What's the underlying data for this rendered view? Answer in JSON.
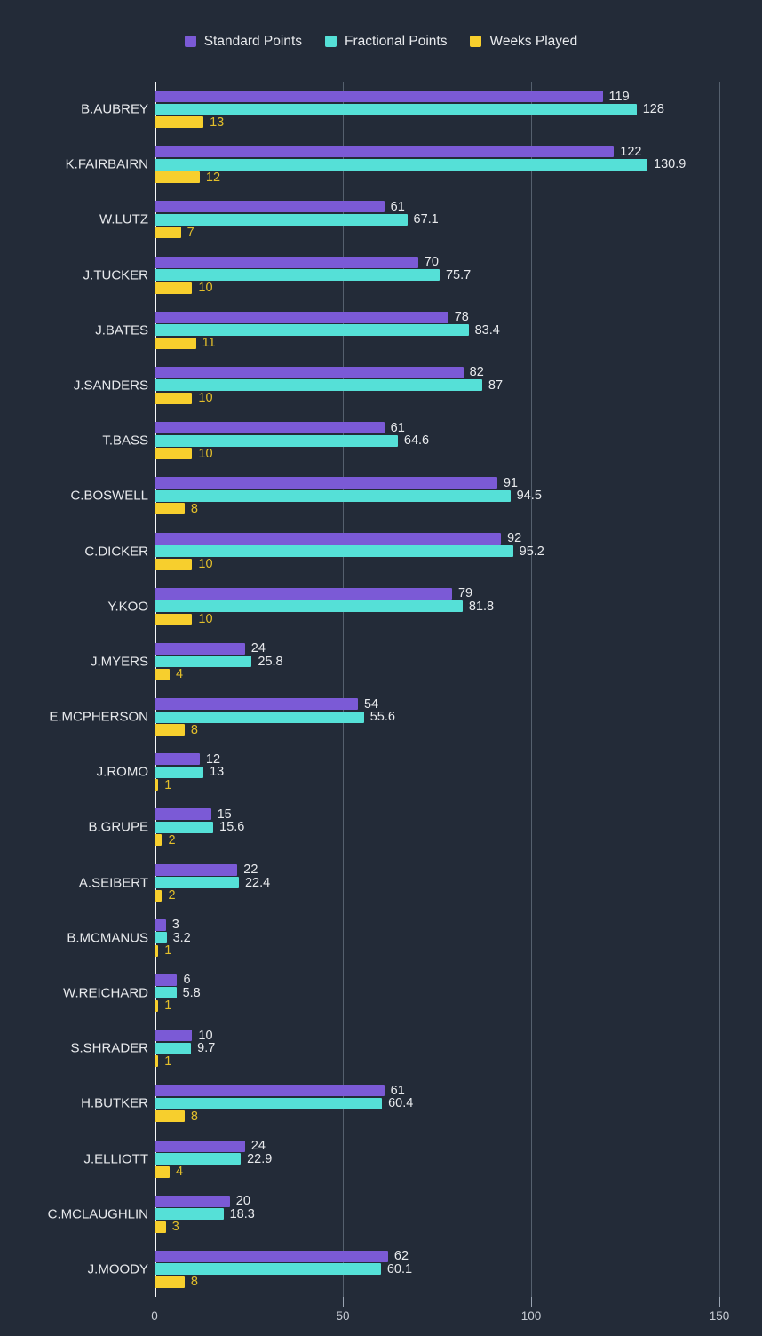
{
  "legend": {
    "items": [
      {
        "label": "Standard Points",
        "color": "#7b5ad6",
        "icon": "square-swatch"
      },
      {
        "label": "Fractional Points",
        "color": "#55e0d7",
        "icon": "square-swatch"
      },
      {
        "label": "Weeks Played",
        "color": "#f7cf2d",
        "icon": "square-swatch"
      }
    ]
  },
  "axis": {
    "x_ticks": [
      "0",
      "50",
      "100",
      "150"
    ],
    "x_tick_values": [
      0,
      50,
      100,
      150
    ]
  },
  "chart_data": {
    "type": "bar",
    "orientation": "horizontal",
    "title": "",
    "subtitle": "",
    "xlabel": "",
    "ylabel": "",
    "xlim": [
      0,
      150
    ],
    "grid": true,
    "legend_position": "top-center",
    "colors": {
      "standard_points": "#7b5ad6",
      "fractional_points": "#55e0d7",
      "weeks_played": "#f7cf2d",
      "background": "#232b38",
      "axis": "#f4f6f8",
      "gridline": "#55606e",
      "text": "#e8eaed",
      "weeks_label_text": "#e3bf2b"
    },
    "categories": [
      "B.AUBREY",
      "K.FAIRBAIRN",
      "W.LUTZ",
      "J.TUCKER",
      "J.BATES",
      "J.SANDERS",
      "T.BASS",
      "C.BOSWELL",
      "C.DICKER",
      "Y.KOO",
      "J.MYERS",
      "E.MCPHERSON",
      "J.ROMO",
      "B.GRUPE",
      "A.SEIBERT",
      "B.MCMANUS",
      "W.REICHARD",
      "S.SHRADER",
      "H.BUTKER",
      "J.ELLIOTT",
      "C.MCLAUGHLIN",
      "J.MOODY"
    ],
    "series": [
      {
        "name": "Standard Points",
        "color": "#7b5ad6",
        "values": [
          119,
          122,
          61,
          70,
          78,
          82,
          61,
          91,
          92,
          79,
          24,
          54,
          12,
          15,
          22,
          3,
          6,
          10,
          61,
          24,
          20,
          62
        ],
        "labels": [
          "119",
          "122",
          "61",
          "70",
          "78",
          "82",
          "61",
          "91",
          "92",
          "79",
          "24",
          "54",
          "12",
          "15",
          "22",
          "3",
          "6",
          "10",
          "61",
          "24",
          "20",
          "62"
        ]
      },
      {
        "name": "Fractional Points",
        "color": "#55e0d7",
        "values": [
          128,
          130.9,
          67.1,
          75.7,
          83.4,
          87,
          64.6,
          94.5,
          95.2,
          81.8,
          25.8,
          55.6,
          13,
          15.6,
          22.4,
          3.2,
          5.8,
          9.7,
          60.4,
          22.9,
          18.3,
          60.1
        ],
        "labels": [
          "128",
          "130.9",
          "67.1",
          "75.7",
          "83.4",
          "87",
          "64.6",
          "94.5",
          "95.2",
          "81.8",
          "25.8",
          "55.6",
          "13",
          "15.6",
          "22.4",
          "3.2",
          "5.8",
          "9.7",
          "60.4",
          "22.9",
          "18.3",
          "60.1"
        ]
      },
      {
        "name": "Weeks Played",
        "color": "#f7cf2d",
        "values": [
          13,
          12,
          7,
          10,
          11,
          10,
          10,
          8,
          10,
          10,
          4,
          8,
          1,
          2,
          2,
          1,
          1,
          1,
          8,
          4,
          3,
          8
        ],
        "labels": [
          "13",
          "12",
          "7",
          "10",
          "11",
          "10",
          "10",
          "8",
          "10",
          "10",
          "4",
          "8",
          "1",
          "2",
          "2",
          "1",
          "1",
          "1",
          "8",
          "4",
          "3",
          "8"
        ]
      }
    ]
  }
}
